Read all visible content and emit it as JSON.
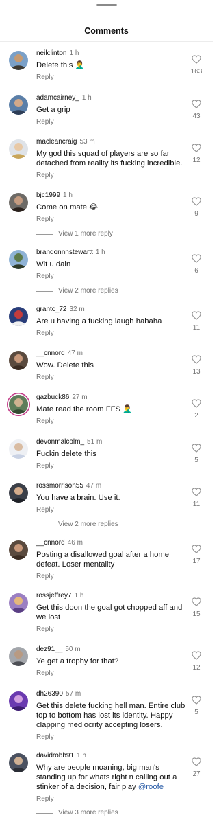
{
  "header": {
    "title": "Comments"
  },
  "comments": [
    {
      "user": "neilclinton",
      "time": "1 h",
      "text": "Delete this",
      "emoji": "🤦‍♂️",
      "likes": "163",
      "reply": "Reply",
      "avatar": "avatar-cyclist"
    },
    {
      "user": "adamcairney_",
      "time": "1 h",
      "text": "Get a grip",
      "emoji": "",
      "likes": "43",
      "reply": "Reply",
      "avatar": "avatar-man"
    },
    {
      "user": "macleancraig",
      "time": "53 m",
      "text": "My god this squad of players are so far detached from reality its fucking incredible.",
      "emoji": "",
      "likes": "12",
      "reply": "Reply",
      "avatar": "avatar-blonde"
    },
    {
      "user": "bjc1999",
      "time": "1 h",
      "text": "Come on mate",
      "emoji": "😂",
      "likes": "9",
      "reply": "Reply",
      "avatar": "avatar-dark-hair"
    },
    {
      "user": "brandonnnstewartt",
      "time": "1 h",
      "text": "Wit u dain",
      "emoji": "",
      "likes": "6",
      "reply": "Reply",
      "avatar": "avatar-outdoors"
    },
    {
      "user": "grantc_72",
      "time": "32 m",
      "text": "Are u having a fucking laugh hahaha",
      "emoji": "",
      "likes": "11",
      "reply": "Reply",
      "avatar": "avatar-stadium"
    },
    {
      "user": "__cnnord",
      "time": "47 m",
      "text": "Wow. Delete this",
      "emoji": "",
      "likes": "13",
      "reply": "Reply",
      "avatar": "avatar-face"
    },
    {
      "user": "gazbuck86",
      "time": "27 m",
      "text": "Mate read the room FFS",
      "emoji": "🤦‍♂️",
      "likes": "2",
      "reply": "Reply",
      "avatar": "avatar-group"
    },
    {
      "user": "devonmalcolm_",
      "time": "51 m",
      "text": "Fuckin delete this",
      "emoji": "",
      "likes": "5",
      "reply": "Reply",
      "avatar": "avatar-light"
    },
    {
      "user": "rossmorrison55",
      "time": "47 m",
      "text": "You have a brain. Use it.",
      "emoji": "",
      "likes": "11",
      "reply": "Reply",
      "avatar": "avatar-suit"
    },
    {
      "user": "__cnnord",
      "time": "46 m",
      "text": "Posting a disallowed goal after a home defeat. Loser mentality",
      "emoji": "",
      "likes": "17",
      "reply": "Reply",
      "avatar": "avatar-face"
    },
    {
      "user": "rossjeffrey7",
      "time": "1 h",
      "text": "Get this doon the goal got chopped aff and we lost",
      "emoji": "",
      "likes": "15",
      "reply": "Reply",
      "avatar": "avatar-crowd"
    },
    {
      "user": "dez91__",
      "time": "50 m",
      "text": "Ye get a trophy for that?",
      "emoji": "",
      "likes": "12",
      "reply": "Reply",
      "avatar": "avatar-street"
    },
    {
      "user": "dh26390",
      "time": "57 m",
      "text": "Get this delete fucking hell man. Entire club top to bottom has lost its identity. Happy clapping mediocrity accepting losers.",
      "emoji": "",
      "likes": "5",
      "reply": "Reply",
      "avatar": "avatar-purple"
    },
    {
      "user": "davidrobb91",
      "time": "1 h",
      "text": "Why are people moaning, big man's standing up for whats right n calling out a stinker of a decision, fair play",
      "mention": "@roofe",
      "emoji": "",
      "likes": "27",
      "reply": "Reply",
      "avatar": "avatar-portrait"
    }
  ],
  "view_more": [
    {
      "label": "View 1 more reply"
    },
    {
      "label": "View 2 more replies"
    },
    {
      "label": "View 2 more replies"
    },
    {
      "label": "View 3 more replies"
    }
  ],
  "colors": {
    "accent_ring": "#c13584",
    "mention": "#2c5ea8",
    "muted": "#737373"
  }
}
